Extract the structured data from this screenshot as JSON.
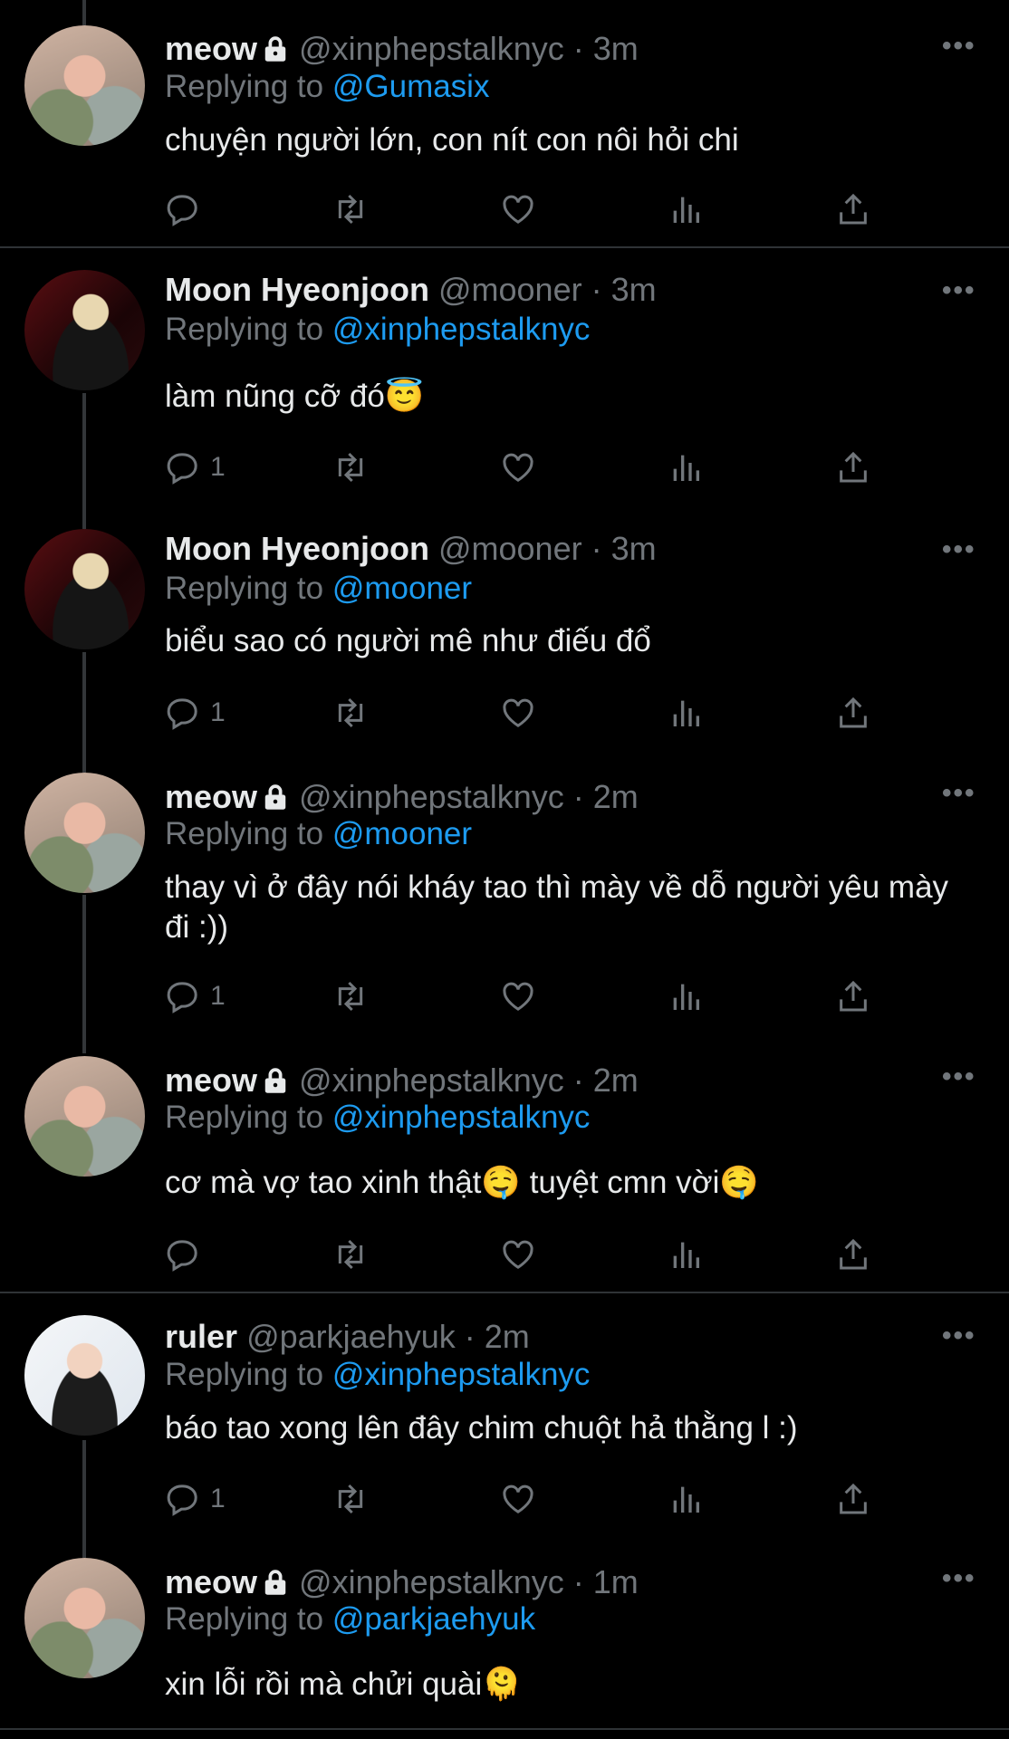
{
  "tweets": [
    {
      "name": "meow",
      "locked": true,
      "handle": "@xinphepstalknyc",
      "time": "3m",
      "replying_label": "Replying to",
      "replying_to": "@Gumasix",
      "text": "chuyện người lớn, con nít con nôi hỏi chi",
      "reply_count": ""
    },
    {
      "name": "Moon Hyeonjoon",
      "locked": false,
      "handle": "@mooner",
      "time": "3m",
      "replying_label": "Replying to",
      "replying_to": "@xinphepstalknyc",
      "text": "làm nũng cỡ đó😇",
      "reply_count": "1"
    },
    {
      "name": "Moon Hyeonjoon",
      "locked": false,
      "handle": "@mooner",
      "time": "3m",
      "replying_label": "Replying to",
      "replying_to": "@mooner",
      "text": "biểu sao có người mê như điếu đổ",
      "reply_count": "1"
    },
    {
      "name": "meow",
      "locked": true,
      "handle": "@xinphepstalknyc",
      "time": "2m",
      "replying_label": "Replying to",
      "replying_to": "@mooner",
      "text": "thay vì ở đây nói kháy tao thì mày về dỗ người yêu mày đi :))",
      "reply_count": "1"
    },
    {
      "name": "meow",
      "locked": true,
      "handle": "@xinphepstalknyc",
      "time": "2m",
      "replying_label": "Replying to",
      "replying_to": "@xinphepstalknyc",
      "text": "cơ mà vợ tao xinh thật🤤  tuyệt cmn vời🤤",
      "reply_count": ""
    },
    {
      "name": "ruler",
      "locked": false,
      "handle": "@parkjaehyuk",
      "time": "2m",
      "replying_label": "Replying to",
      "replying_to": "@xinphepstalknyc",
      "text": "báo tao xong lên đây chim chuột hả thằng l :)",
      "reply_count": "1"
    },
    {
      "name": "meow",
      "locked": true,
      "handle": "@xinphepstalknyc",
      "time": "1m",
      "replying_label": "Replying to",
      "replying_to": "@parkjaehyuk",
      "text": "xin lỗi rồi mà chửi quài🫠",
      "reply_count": ""
    }
  ],
  "separator": "·",
  "more_label": "•••",
  "icons": {
    "reply": "reply-icon",
    "retweet": "retweet-icon",
    "like": "heart-icon",
    "views": "views-icon",
    "share": "share-icon",
    "lock": "lock-icon",
    "more": "more-icon"
  }
}
